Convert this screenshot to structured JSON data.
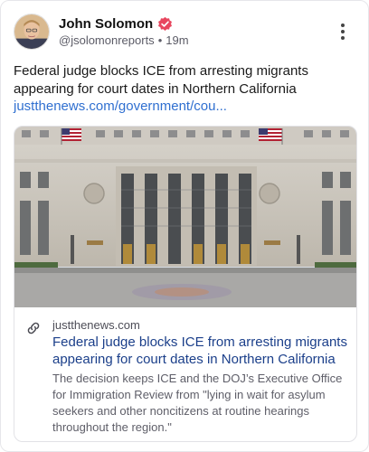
{
  "post": {
    "author": {
      "display_name": "John Solomon",
      "handle": "@jsolomonreports",
      "separator": "•",
      "time": "19m",
      "avatar_icon": "avatar-photo",
      "verified_icon": "verified-badge-icon",
      "verified_color": "#e8465e"
    },
    "text": "Federal judge blocks ICE from arresting migrants appearing for court dates in Northern California",
    "link_text": "justthenews.com/government/cou...",
    "link_color": "#2f6fd0",
    "more_icon": "more-vertical-icon",
    "card": {
      "image_icon": "courthouse-photo",
      "link_icon": "link-icon",
      "domain": "justthenews.com",
      "title": "Federal judge blocks ICE from arresting migrants appearing for court dates in Northern California",
      "description": "The decision keeps ICE and the DOJ’s Executive Office for Immigration Review from \"lying in wait for asylum seekers and other noncitizens at routine hearings throughout the region.\""
    }
  }
}
